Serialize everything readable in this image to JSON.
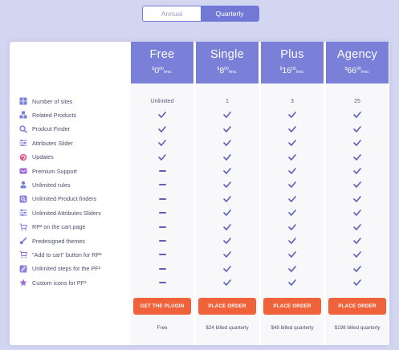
{
  "billing_toggle": {
    "options": [
      "Annual",
      "Quarterly"
    ],
    "selected": "Quarterly"
  },
  "colors": {
    "accent": "#7a7fd8",
    "cta": "#f0623a",
    "check": "#5b60b8"
  },
  "plans": [
    {
      "name": "Free",
      "price_symbol": "$",
      "amount": "0",
      "cents": "00",
      "period": "/mo.",
      "cta": "GET THE PLUGIN",
      "footer": "Free"
    },
    {
      "name": "Single",
      "price_symbol": "$",
      "amount": "8",
      "cents": "00",
      "period": "/mo.",
      "cta": "PLACE ORDER",
      "footer": "$24 billed quarterly"
    },
    {
      "name": "Plus",
      "price_symbol": "$",
      "amount": "16",
      "cents": "00",
      "period": "/mo.",
      "cta": "PLACE ORDER",
      "footer": "$48 billed quarterly"
    },
    {
      "name": "Agency",
      "price_symbol": "$",
      "amount": "66",
      "cents": "00",
      "period": "/mo.",
      "cta": "PLACE ORDER",
      "footer": "$198 billed quarterly"
    }
  ],
  "features": [
    {
      "label": "Number of sites",
      "icon": "grid-icon",
      "values": [
        "Unlimited",
        "1",
        "3",
        "25"
      ]
    },
    {
      "label": "Related Products",
      "icon": "boxes-icon",
      "values": [
        "check",
        "check",
        "check",
        "check"
      ]
    },
    {
      "label": "Prodcut Finder",
      "icon": "search-icon",
      "values": [
        "check",
        "check",
        "check",
        "check"
      ]
    },
    {
      "label": "Attributes Slider",
      "icon": "sliders-icon",
      "values": [
        "check",
        "check",
        "check",
        "check"
      ]
    },
    {
      "label": "Updates",
      "icon": "refresh-icon",
      "values": [
        "check",
        "check",
        "check",
        "check"
      ]
    },
    {
      "label": "Premium Support",
      "icon": "support-icon",
      "values": [
        "dash",
        "check",
        "check",
        "check"
      ]
    },
    {
      "label": "Unlimited rules",
      "icon": "rules-icon",
      "values": [
        "dash",
        "check",
        "check",
        "check"
      ]
    },
    {
      "label": "Unlimited Product finders",
      "icon": "finder-icon",
      "values": [
        "dash",
        "check",
        "check",
        "check"
      ]
    },
    {
      "label": "Unlimited Attributes Sliders",
      "icon": "sliders-icon",
      "values": [
        "dash",
        "check",
        "check",
        "check"
      ]
    },
    {
      "label": "RP² on the cart page",
      "icon": "cart-icon",
      "values": [
        "dash",
        "check",
        "check",
        "check"
      ]
    },
    {
      "label": "Predesigned themes",
      "icon": "brush-icon",
      "values": [
        "dash",
        "check",
        "check",
        "check"
      ]
    },
    {
      "label": "\"Add to cart\" button for RP²",
      "icon": "cart-add-icon",
      "values": [
        "dash",
        "check",
        "check",
        "check"
      ]
    },
    {
      "label": "Unlimited steps for the PF²",
      "icon": "steps-icon",
      "values": [
        "dash",
        "check",
        "check",
        "check"
      ]
    },
    {
      "label": "Custom icons for PF²",
      "icon": "star-icon",
      "values": [
        "dash",
        "check",
        "check",
        "check"
      ]
    }
  ]
}
